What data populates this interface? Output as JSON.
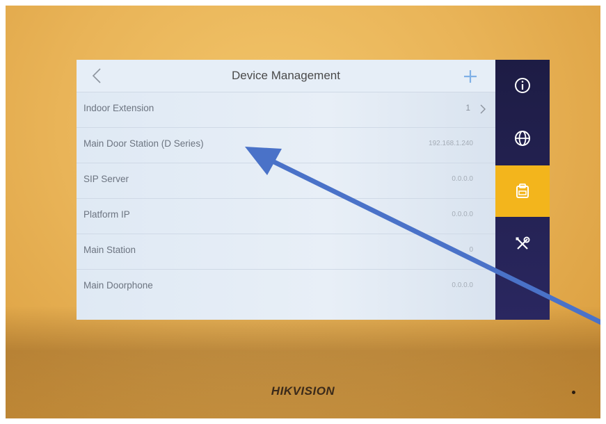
{
  "header": {
    "title": "Device Management"
  },
  "rows": [
    {
      "label": "Indoor Extension",
      "value": "1"
    },
    {
      "label": "Main Door Station (D Series)",
      "value": "192.168.1.240"
    },
    {
      "label": "SIP Server",
      "value": "0.0.0.0"
    },
    {
      "label": "Platform IP",
      "value": "0.0.0.0"
    },
    {
      "label": "Main Station",
      "value": "0"
    },
    {
      "label": "Main Doorphone",
      "value": "0.0.0.0"
    }
  ],
  "sidebar": {
    "items": [
      {
        "icon": "info-icon"
      },
      {
        "icon": "globe-icon"
      },
      {
        "icon": "device-management-icon",
        "active": true
      },
      {
        "icon": "tools-icon"
      }
    ]
  },
  "device": {
    "brand": "HIKVISION"
  },
  "colors": {
    "accent": "#f3b51c",
    "sidebar": "#1d1c44",
    "add_icon": "#7fb0e6",
    "annotation_arrow": "#4a72c8"
  }
}
